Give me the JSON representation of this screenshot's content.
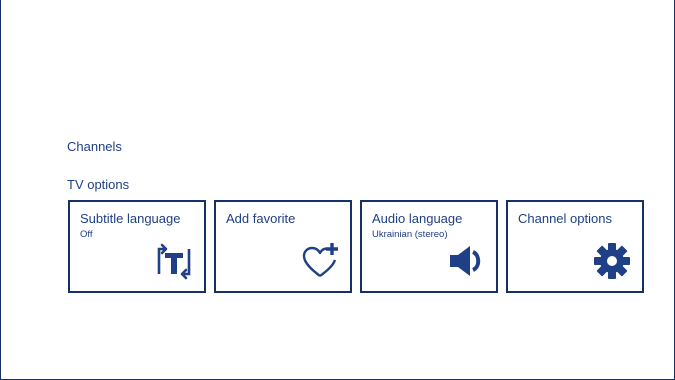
{
  "sections": {
    "channels_label": "Channels",
    "tv_options_label": "TV options"
  },
  "cards": [
    {
      "title": "Subtitle language",
      "subtitle": "Off",
      "icon": "subtitle-t-icon"
    },
    {
      "title": "Add favorite",
      "subtitle": "",
      "icon": "heart-plus-icon"
    },
    {
      "title": "Audio language",
      "subtitle": "Ukrainian (stereo)",
      "icon": "speaker-icon"
    },
    {
      "title": "Channel options",
      "subtitle": "",
      "icon": "gear-icon"
    }
  ],
  "colors": {
    "accent": "#1f3f86",
    "border": "#16306a",
    "background": "#ffffff"
  }
}
